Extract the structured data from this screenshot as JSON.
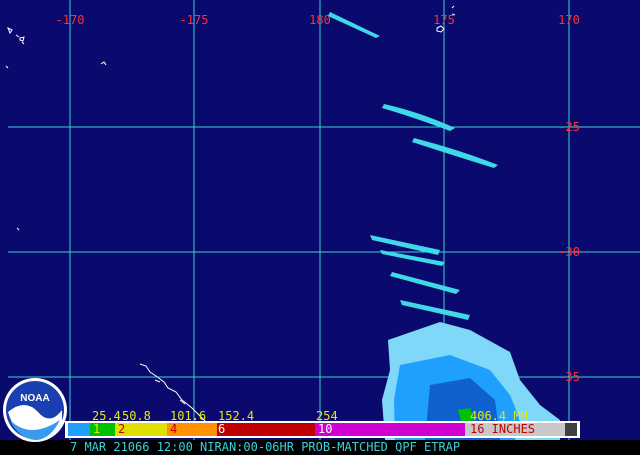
{
  "map": {
    "ocean_color": "#0a0a6e",
    "grid_color": "#3fd0d8",
    "lon_label_color": "#ff3030",
    "lat_label_color": "#ff3030",
    "longitude_labels": [
      "-170",
      "-175",
      "180",
      "175",
      "170"
    ],
    "latitude_labels": [
      "-25",
      "-30",
      "-35"
    ]
  },
  "legend": {
    "mm_labels": [
      "25.4",
      "50.8",
      "101.6",
      "152.4",
      "254",
      "406.4 MM"
    ],
    "inch_labels": [
      "1",
      "2",
      "4",
      "6",
      "10",
      "16 INCHES"
    ],
    "colors": [
      "#1fa0ff",
      "#00c000",
      "#e0e000",
      "#ff9000",
      "#c00000",
      "#d000d0",
      "#c8c8c8"
    ]
  },
  "caption": "7 MAR 21066 12:00 NIRAN:00-06HR PROB-MATCHED QPF ETRAP",
  "logo": {
    "text": "NOAA"
  }
}
